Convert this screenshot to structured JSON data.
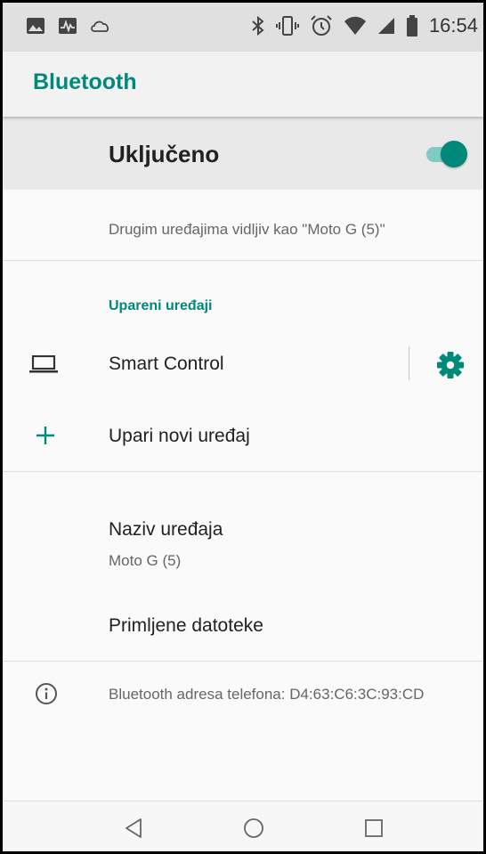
{
  "status_bar": {
    "time": "16:54",
    "left_icons": [
      "image-notification-icon",
      "activity-notification-icon",
      "cloud-notification-icon"
    ],
    "right_icons": [
      "bluetooth-icon",
      "vibrate-icon",
      "alarm-icon",
      "wifi-icon",
      "cell-signal-icon",
      "battery-icon"
    ]
  },
  "app_bar": {
    "title": "Bluetooth"
  },
  "master_switch": {
    "label": "Uključeno",
    "state": "on"
  },
  "visibility_text": "Drugim uređajima vidljiv kao \"Moto G (5)\"",
  "paired_devices": {
    "header": "Upareni uređaji",
    "devices": [
      {
        "name": "Smart Control",
        "icon": "laptop-icon"
      }
    ]
  },
  "pair_new": {
    "label": "Upari novi uređaj",
    "icon": "plus-icon"
  },
  "device_name": {
    "label": "Naziv uređaja",
    "value": "Moto G (5)"
  },
  "received_files": {
    "label": "Primljene datoteke"
  },
  "bluetooth_address": {
    "text": "Bluetooth adresa telefona: D4:63:C6:3C:93:CD",
    "icon": "info-icon"
  },
  "nav_bar": {
    "buttons": [
      "back-icon",
      "home-icon",
      "recents-icon"
    ]
  },
  "colors": {
    "accent": "#00897b",
    "toggle_track": "#80cbc4",
    "status_bar_bg": "#e0e0e0",
    "master_row_bg": "#e9e9e9",
    "primary_text": "#212121",
    "secondary_text": "#666666"
  }
}
